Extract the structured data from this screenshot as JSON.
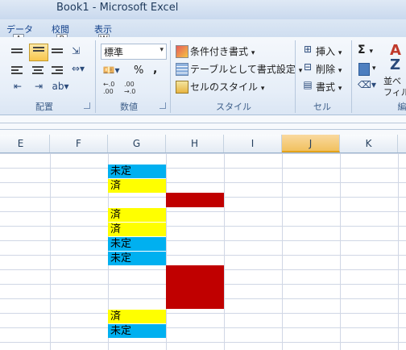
{
  "window": {
    "title": "Book1  -  Microsoft Excel"
  },
  "tabs": [
    {
      "label": "データ",
      "keytip": "A"
    },
    {
      "label": "校閲",
      "keytip": "R"
    },
    {
      "label": "表示",
      "keytip": "W"
    }
  ],
  "ribbon": {
    "alignment_group": {
      "label": "配置"
    },
    "number_group": {
      "label": "数値",
      "format_value": "標準",
      "percent": "%",
      "comma": ",",
      "inc_decimal": "←.0\n.00",
      "dec_decimal": ".00\n→.0"
    },
    "style_group": {
      "label": "スタイル",
      "conditional_format": "条件付き書式",
      "format_as_table": "テーブルとして書式設定",
      "cell_styles": "セルのスタイル"
    },
    "cells_group": {
      "label": "セル",
      "insert": "挿入",
      "delete": "削除",
      "format": "書式"
    },
    "editing_group": {
      "label": "編",
      "sort_filter_line1": "並べ",
      "sort_filter_line2": "フィル",
      "sigma": "Σ"
    }
  },
  "grid": {
    "columns": [
      "E",
      "F",
      "G",
      "H",
      "I",
      "J",
      "K"
    ],
    "selected_column": "J",
    "cells_g": [
      {
        "row": 1,
        "text": "未定",
        "color": "#00b0f0"
      },
      {
        "row": 2,
        "text": "済",
        "color": "#ffff00"
      },
      {
        "row": 4,
        "text": "済",
        "color": "#ffff00"
      },
      {
        "row": 5,
        "text": "済",
        "color": "#ffff00"
      },
      {
        "row": 6,
        "text": "未定",
        "color": "#00b0f0"
      },
      {
        "row": 7,
        "text": "未定",
        "color": "#00b0f0"
      },
      {
        "row": 11,
        "text": "済",
        "color": "#ffff00"
      },
      {
        "row": 12,
        "text": "未定",
        "color": "#00b0f0"
      }
    ],
    "red_fill_color": "#c00000"
  }
}
